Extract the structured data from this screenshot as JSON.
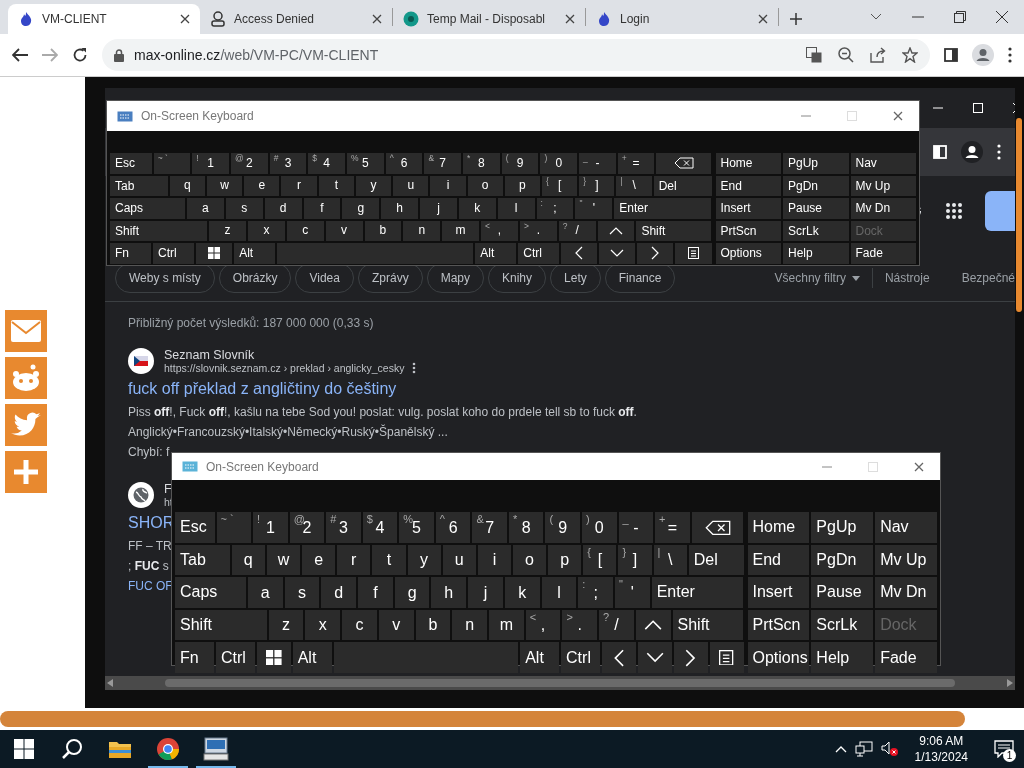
{
  "chrome": {
    "tabs": [
      {
        "kind": "flame",
        "title": "VM-CLIENT",
        "selected": true
      },
      {
        "kind": "figure",
        "title": "Access Denied",
        "selected": false
      },
      {
        "kind": "circle",
        "title": "Temp Mail - Disposabl",
        "selected": false
      },
      {
        "kind": "flame",
        "title": "Login",
        "selected": false
      }
    ],
    "address": {
      "host": "max-online.cz",
      "path": "/web/VM-PC/VM-CLIENT"
    }
  },
  "share_bar": [
    {
      "kind": "mail"
    },
    {
      "kind": "reddit"
    },
    {
      "kind": "twitter"
    },
    {
      "kind": "plus"
    }
  ],
  "remote_browser": {
    "filters": [
      "Weby s místy",
      "Obrázky",
      "Videa",
      "Zprávy",
      "Mapy",
      "Knihy",
      "Lety",
      "Finance"
    ],
    "all_filters": "Všechny filtry",
    "tools": "Nástroje",
    "safe_search": "Bezpečné",
    "result_count": "Přibližný počet výsledků: 187 000 000 (0,33 s)",
    "results": [
      {
        "kind": "flag",
        "site": "Seznam Slovník",
        "url": "https://slovnik.seznam.cz › preklad › anglicky_cesky",
        "title": "fuck off překlad z angličtiny do češtiny",
        "lines": [
          "Piss **off**!, Fuck **off**!, kašlu na tebe Sod you! poslat: vulg. poslat koho do prdele tell sb to fuck **off**. Anglický•Francouzský•Italský•Německý•Ruský•Španělský ...",
          "Chybí: f"
        ]
      },
      {
        "kind": "globe",
        "site": "F",
        "url": "ht",
        "title": "SHOR",
        "lines": [
          "FF – TR",
          "; **FUC** s"
        ],
        "sitelink": "FUC OF"
      }
    ]
  },
  "keyboards": [
    {
      "title": "On-Screen Keyboard",
      "key_rows": [
        {
          "keys": [
            {
              "kind": "label",
              "text": "Esc"
            },
            {
              "kind": "char",
              "top": "~ `"
            },
            {
              "kind": "char",
              "top": "!",
              "main": "1"
            },
            {
              "kind": "char",
              "top": "@",
              "main": "2"
            },
            {
              "kind": "char",
              "top": "#",
              "main": "3"
            },
            {
              "kind": "char",
              "top": "$",
              "main": "4"
            },
            {
              "kind": "char",
              "top": "%",
              "main": "5"
            },
            {
              "kind": "char",
              "top": "^",
              "main": "6"
            },
            {
              "kind": "char",
              "top": "&",
              "main": "7"
            },
            {
              "kind": "char",
              "top": "*",
              "main": "8"
            },
            {
              "kind": "char",
              "top": "(",
              "main": "9"
            },
            {
              "kind": "char",
              "top": ")",
              "main": "0"
            },
            {
              "kind": "char",
              "top": "_",
              "main": "-"
            },
            {
              "kind": "char",
              "top": "+",
              "main": "="
            },
            {
              "kind": "backspace"
            }
          ]
        },
        {
          "keys": [
            {
              "kind": "wide",
              "text": "Tab"
            },
            {
              "kind": "char",
              "main": "q"
            },
            {
              "kind": "char",
              "main": "w"
            },
            {
              "kind": "char",
              "main": "e"
            },
            {
              "kind": "char",
              "main": "r"
            },
            {
              "kind": "char",
              "main": "t"
            },
            {
              "kind": "char",
              "main": "y"
            },
            {
              "kind": "char",
              "main": "u"
            },
            {
              "kind": "char",
              "main": "i"
            },
            {
              "kind": "char",
              "main": "o"
            },
            {
              "kind": "char",
              "main": "p"
            },
            {
              "kind": "char",
              "top": "{",
              "main": "["
            },
            {
              "kind": "char",
              "top": "}",
              "main": "]"
            },
            {
              "kind": "char",
              "top": "|",
              "main": "\\"
            },
            {
              "kind": "wide",
              "text": "Del"
            }
          ]
        },
        {
          "keys": [
            {
              "kind": "wider",
              "text": "Caps"
            },
            {
              "kind": "char",
              "main": "a"
            },
            {
              "kind": "char",
              "main": "s"
            },
            {
              "kind": "char",
              "main": "d"
            },
            {
              "kind": "char",
              "main": "f"
            },
            {
              "kind": "char",
              "main": "g"
            },
            {
              "kind": "char",
              "main": "h"
            },
            {
              "kind": "char",
              "main": "j"
            },
            {
              "kind": "char",
              "main": "k"
            },
            {
              "kind": "char",
              "main": "l"
            },
            {
              "kind": "char",
              "top": ":",
              "main": ";"
            },
            {
              "kind": "char",
              "top": "\"",
              "main": "'"
            },
            {
              "kind": "widest",
              "text": "Enter"
            }
          ]
        },
        {
          "keys": [
            {
              "kind": "widest",
              "text": "Shift"
            },
            {
              "kind": "char",
              "main": "z"
            },
            {
              "kind": "char",
              "main": "x"
            },
            {
              "kind": "char",
              "main": "c"
            },
            {
              "kind": "char",
              "main": "v"
            },
            {
              "kind": "char",
              "main": "b"
            },
            {
              "kind": "char",
              "main": "n"
            },
            {
              "kind": "char",
              "main": "m"
            },
            {
              "kind": "char",
              "top": "<",
              "main": ","
            },
            {
              "kind": "char",
              "top": ">",
              "main": "."
            },
            {
              "kind": "char",
              "top": "?",
              "main": "/"
            },
            {
              "kind": "up"
            },
            {
              "kind": "wider",
              "text": "Shift"
            }
          ]
        },
        {
          "keys": [
            {
              "kind": "label",
              "text": "Fn"
            },
            {
              "kind": "label",
              "text": "Ctrl"
            },
            {
              "kind": "windows"
            },
            {
              "kind": "label",
              "text": "Alt"
            },
            {
              "kind": "space"
            },
            {
              "kind": "label",
              "text": "Alt"
            },
            {
              "kind": "label",
              "text": "Ctrl"
            },
            {
              "kind": "left"
            },
            {
              "kind": "down"
            },
            {
              "kind": "right"
            },
            {
              "kind": "menu"
            }
          ]
        }
      ],
      "nav": [
        {
          "text": "Home",
          "disabled": false
        },
        {
          "text": "PgUp",
          "disabled": false
        },
        {
          "text": "Nav",
          "disabled": false
        },
        {
          "text": "End",
          "disabled": false
        },
        {
          "text": "PgDn",
          "disabled": false
        },
        {
          "text": "Mv Up",
          "disabled": false
        },
        {
          "text": "Insert",
          "disabled": false
        },
        {
          "text": "Pause",
          "disabled": false
        },
        {
          "text": "Mv Dn",
          "disabled": false
        },
        {
          "text": "PrtScn",
          "disabled": false
        },
        {
          "text": "ScrLk",
          "disabled": false
        },
        {
          "text": "Dock",
          "disabled": true
        },
        {
          "text": "Options",
          "disabled": false
        },
        {
          "text": "Help",
          "disabled": false
        },
        {
          "text": "Fade",
          "disabled": false
        }
      ]
    },
    {
      "title": "On-Screen Keyboard",
      "key_rows": [
        {
          "keys": [
            {
              "kind": "label",
              "text": "Esc"
            },
            {
              "kind": "char",
              "top": "~ `"
            },
            {
              "kind": "char",
              "top": "!",
              "main": "1"
            },
            {
              "kind": "char",
              "top": "@",
              "main": "2"
            },
            {
              "kind": "char",
              "top": "#",
              "main": "3"
            },
            {
              "kind": "char",
              "top": "$",
              "main": "4"
            },
            {
              "kind": "char",
              "top": "%",
              "main": "5"
            },
            {
              "kind": "char",
              "top": "^",
              "main": "6"
            },
            {
              "kind": "char",
              "top": "&",
              "main": "7"
            },
            {
              "kind": "char",
              "top": "*",
              "main": "8"
            },
            {
              "kind": "char",
              "top": "(",
              "main": "9"
            },
            {
              "kind": "char",
              "top": ")",
              "main": "0"
            },
            {
              "kind": "char",
              "top": "_",
              "main": "-"
            },
            {
              "kind": "char",
              "top": "+",
              "main": "="
            },
            {
              "kind": "backspace"
            }
          ]
        },
        {
          "keys": [
            {
              "kind": "wide",
              "text": "Tab"
            },
            {
              "kind": "char",
              "main": "q"
            },
            {
              "kind": "char",
              "main": "w"
            },
            {
              "kind": "char",
              "main": "e"
            },
            {
              "kind": "char",
              "main": "r"
            },
            {
              "kind": "char",
              "main": "t"
            },
            {
              "kind": "char",
              "main": "y"
            },
            {
              "kind": "char",
              "main": "u"
            },
            {
              "kind": "char",
              "main": "i"
            },
            {
              "kind": "char",
              "main": "o"
            },
            {
              "kind": "char",
              "main": "p"
            },
            {
              "kind": "char",
              "top": "{",
              "main": "["
            },
            {
              "kind": "char",
              "top": "}",
              "main": "]"
            },
            {
              "kind": "char",
              "top": "|",
              "main": "\\"
            },
            {
              "kind": "wide",
              "text": "Del"
            }
          ]
        },
        {
          "keys": [
            {
              "kind": "wider",
              "text": "Caps"
            },
            {
              "kind": "char",
              "main": "a"
            },
            {
              "kind": "char",
              "main": "s"
            },
            {
              "kind": "char",
              "main": "d"
            },
            {
              "kind": "char",
              "main": "f"
            },
            {
              "kind": "char",
              "main": "g"
            },
            {
              "kind": "char",
              "main": "h"
            },
            {
              "kind": "char",
              "main": "j"
            },
            {
              "kind": "char",
              "main": "k"
            },
            {
              "kind": "char",
              "main": "l"
            },
            {
              "kind": "char",
              "top": ":",
              "main": ";"
            },
            {
              "kind": "char",
              "top": "\"",
              "main": "'"
            },
            {
              "kind": "widest",
              "text": "Enter"
            }
          ]
        },
        {
          "keys": [
            {
              "kind": "widest",
              "text": "Shift"
            },
            {
              "kind": "char",
              "main": "z"
            },
            {
              "kind": "char",
              "main": "x"
            },
            {
              "kind": "char",
              "main": "c"
            },
            {
              "kind": "char",
              "main": "v"
            },
            {
              "kind": "char",
              "main": "b"
            },
            {
              "kind": "char",
              "main": "n"
            },
            {
              "kind": "char",
              "main": "m"
            },
            {
              "kind": "char",
              "top": "<",
              "main": ","
            },
            {
              "kind": "char",
              "top": ">",
              "main": "."
            },
            {
              "kind": "char",
              "top": "?",
              "main": "/"
            },
            {
              "kind": "up"
            },
            {
              "kind": "wider",
              "text": "Shift"
            }
          ]
        },
        {
          "keys": [
            {
              "kind": "label",
              "text": "Fn"
            },
            {
              "kind": "label",
              "text": "Ctrl"
            },
            {
              "kind": "windows"
            },
            {
              "kind": "label",
              "text": "Alt"
            },
            {
              "kind": "space"
            },
            {
              "kind": "label",
              "text": "Alt"
            },
            {
              "kind": "label",
              "text": "Ctrl"
            },
            {
              "kind": "left"
            },
            {
              "kind": "down"
            },
            {
              "kind": "right"
            },
            {
              "kind": "menu"
            }
          ]
        }
      ],
      "nav": [
        {
          "text": "Home",
          "disabled": false
        },
        {
          "text": "PgUp",
          "disabled": false
        },
        {
          "text": "Nav",
          "disabled": false
        },
        {
          "text": "End",
          "disabled": false
        },
        {
          "text": "PgDn",
          "disabled": false
        },
        {
          "text": "Mv Up",
          "disabled": false
        },
        {
          "text": "Insert",
          "disabled": false
        },
        {
          "text": "Pause",
          "disabled": false
        },
        {
          "text": "Mv Dn",
          "disabled": false
        },
        {
          "text": "PrtScn",
          "disabled": false
        },
        {
          "text": "ScrLk",
          "disabled": false
        },
        {
          "text": "Dock",
          "disabled": true
        },
        {
          "text": "Options",
          "disabled": false
        },
        {
          "text": "Help",
          "disabled": false
        },
        {
          "text": "Fade",
          "disabled": false
        }
      ]
    }
  ],
  "taskbar": {
    "buttons": [
      {
        "kind": "start",
        "running": false
      },
      {
        "kind": "search",
        "running": false
      },
      {
        "kind": "folder",
        "running": false
      },
      {
        "kind": "chrome",
        "running": true
      },
      {
        "kind": "keyboard",
        "running": true
      }
    ],
    "time": "9:06 AM",
    "date": "1/13/2024",
    "notifications": "1"
  }
}
